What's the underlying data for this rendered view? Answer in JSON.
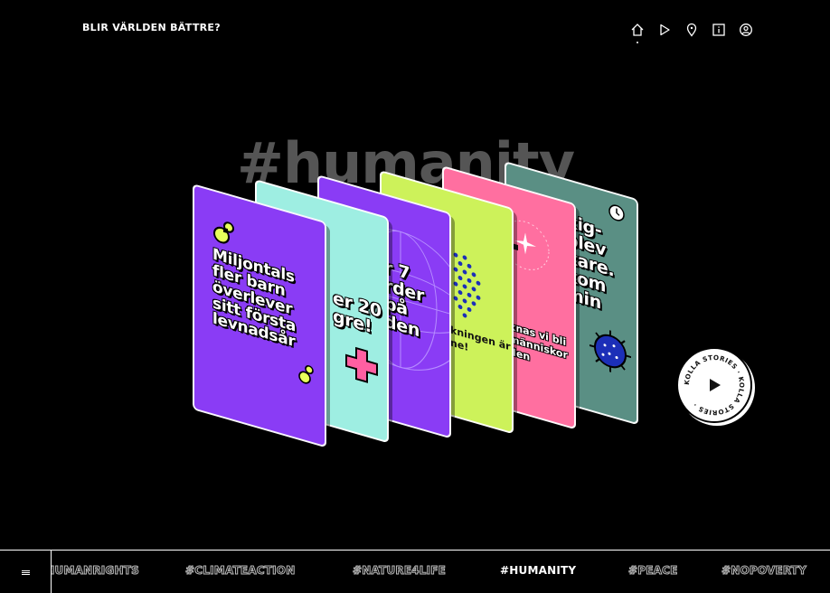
{
  "header": {
    "title": "BLIR VÄRLDEN BÄTTRE?",
    "nav": [
      {
        "icon": "home-icon",
        "active": true
      },
      {
        "icon": "play-icon",
        "active": false
      },
      {
        "icon": "location-pin-icon",
        "active": false
      },
      {
        "icon": "info-icon",
        "active": false
      },
      {
        "icon": "user-icon",
        "active": false
      }
    ]
  },
  "hero": {
    "hashtag": "#humanity"
  },
  "cards": [
    {
      "color": "#8a3cf5",
      "headline": "Miljontals\nfler barn\növerlever\nsitt första\nlevnadsår",
      "sub": ""
    },
    {
      "color": "#9eeee2",
      "headline": "er 20\ngre!",
      "sub": ""
    },
    {
      "color": "#8a3cf5",
      "headline": "r 7\nrder\npå\nden",
      "sub": ""
    },
    {
      "color": "#cdf25a",
      "headline": "",
      "sub": "kningen är\nne!"
    },
    {
      "color": "#ff6fa0",
      "headline": "",
      "sub": "knas vi bli\nmänniskor\nden"
    },
    {
      "color": "#5a8f84",
      "headline": "kig-\n blev\nkare.\nkom\nmin",
      "sub": ""
    }
  ],
  "badge": {
    "text": "KOLLA STORIES · KOLLA STORIES ·"
  },
  "tags": {
    "menu_label": "menu",
    "items": [
      {
        "label": "#HUMANRIGHTS",
        "active": false
      },
      {
        "label": "#CLIMATEACTION",
        "active": false
      },
      {
        "label": "#NATURE4LIFE",
        "active": false
      },
      {
        "label": "#HUMANITY",
        "active": true
      },
      {
        "label": "#PEACE",
        "active": false
      },
      {
        "label": "#NOPOVERTY",
        "active": false
      }
    ]
  }
}
